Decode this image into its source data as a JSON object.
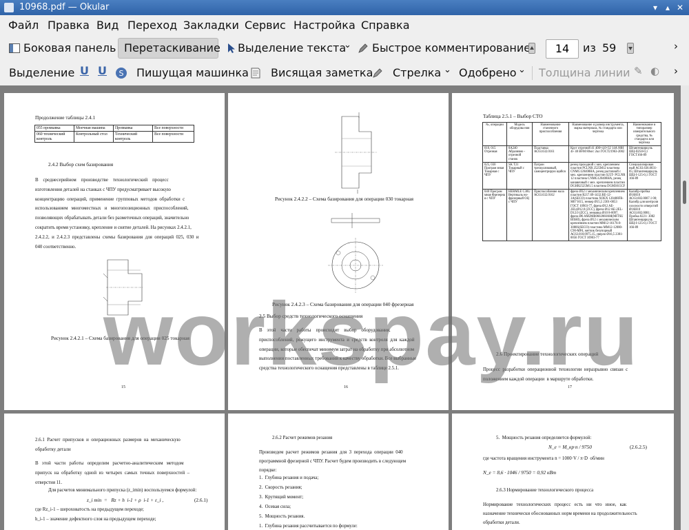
{
  "window": {
    "title": "10968.pdf — Okular"
  },
  "menu": [
    "Файл",
    "Правка",
    "Вид",
    "Переход",
    "Закладки",
    "Сервис",
    "Настройка",
    "Справка"
  ],
  "toolbar1": {
    "sidebar": "Боковая панель",
    "drag": "Перетаскивание",
    "text_select": "Выделение текста",
    "quick_annot": "Быстрое комментирование",
    "page_current": "14",
    "page_of": "из",
    "page_total": "59"
  },
  "toolbar2": {
    "select": "Выделение",
    "typewriter": "Пишущая машинка",
    "note": "Висящая заметка",
    "arrow": "Стрелка",
    "stamp": "Одобрено",
    "line_width": "Толщина линии"
  },
  "watermark": "workspay.ru",
  "page15": {
    "cont": "Продолжение таблицы 2.4.1",
    "table": [
      [
        "055 промывка",
        "Моечная\nмашина",
        "Промывка",
        "Все поверхности"
      ],
      [
        "060\nтехнический\nконтроль",
        "Контрольный\nстол",
        "Технический\nконтроль",
        "Все поверхности"
      ]
    ],
    "heading": "2.4.2 Выбор схем базирования",
    "body": "В    среднесерийном    производстве    технологический    процесс\nизготовления деталей на станках с ЧПУ предусматривает высокую\nконцентрацию  операций,  применение  групповых  методов  обработки  с\nиспользованием   многоместных   и   многопозиционных   приспособлений,\nпозволяющих обрабатывать детали без разметочных операций, значительно\nсократить время установку, крепление и снятие деталей. На рисунках 2.4.2.1,\n2.4.2.2,  и  2.4.2.3  представлены  схемы  базирования  для  операций  025,  030  и\n040 соответственно.",
    "caption": "Рисунок 2.4.2.1 – Схема базирования для операции 025 токарная",
    "num": "15"
  },
  "page16": {
    "caption1": "Рисунок 2.4.2.2 – Схема базирования для операции 030 токарная",
    "caption2": "Рисунок 2.4.2.3 – Схема базирования для операции 040 фрезерная",
    "heading": "2.5 Выбор средств технологического оснащения",
    "body": "В    этой    части    работы    происходит    выбор    оборудования,\nприспособлений,  режущего  инструмента  и  средств  контроля  для  каждой\nоперации, которые обеспечат минимум затрат на обработку при абсолютном\nвыполнении поставленных требований к качеству обработки. Все выбранные\nсредства технологического оснащения представлены в таблице 2.5.1.",
    "num": "16"
  },
  "page17": {
    "table_title": "Таблица 2.5.1 – Выбор СТО",
    "table": [
      [
        "№,\nоперации",
        "Модель\nоборудова\nния",
        "Наименование\nстаночного\nприспособления",
        "Наименование и размер\nинструмента, марка\nматериала, № стандарта\nили чертежа",
        "Наименование и\nтипоразмер\nизмерительного\nсредства, №\nстандарта или\nчертежа"
      ],
      [
        "010, 015\nОтрезная",
        "8А240\nАбразивно\n- отрезной\nстанок",
        "Подставка\nАС63.632.0161",
        "Круг отрезной 41\n400×4,0×32 14А 80Н 4l-\n40 ВFМ 80м/с 2кл\nГОСТ21963-2002",
        "Штангенциркуль\nШЦ-II250-0,1\nГОСТ166-89"
      ],
      [
        "025, 030\nПрограм\nмная\nТокарная\nс ЧПУ",
        "SK T21\nТокарный\nс ЧПУ",
        "Патрон\nтрехкулачковый,\nсамоцентрирую\nщийся",
        "резец проходной с мех.\nкреплением пластин\nPCLNR 2525M12 пластина\nCNMG120408HA, резец\nрасточной с мех.\nкреплением пластин S25T-\nPCLNR 12 пластина\nCNMG120408HA, резец\nканавочный с мех.\nкреплением пластин\nDGHR2525M1.5 пластина\nDGM3015CF",
        "Специализирован\nный\nАС63.636.0031-\n05;\nШтангенциркуль\nШЦ-I-125-0,1\nГОСТ 166-89"
      ],
      [
        "040\nПрограм\nмная\nФрезерна\nя с ЧПУ",
        "HERMLE\nC30U\nВертикаль\nно-\nфрезерный\nОЦ с ЧПУ",
        "Приспособление\nнала\nАС63.632.0162",
        "фреза Ø32 с механическим\nкреплением пластин\nR217.69-1432.RE-12-\n3A(SECO) пластина XOEX\n120408FR-M07 H15, зенкер\nØ15,5 2301-0053 ГОСТ\n10903-77, фреза Ø12 AE-\n2EL(Ø12.0 (ZCC), фреза\nØ12 AE-2EL-D12.0 (ZCC),\nзенковка\nØ10 8-0097, фреза\nØ6\nAM2MB0602060AM(MITSU\nBISHI), фреза Ø12 с\nмеханическим креплением\nпластин MM12-16170.0-\n3080S(SECO) пластина\nMM12-12080-C90-MP4,\nметчик безупорный\nАС63.018.0975.15, сверло\nØ16,5 2301-0056 ГОСТ\n10903-77",
        "Калибр-пробка\nØ16Н10\nАС63.602.0007.1\n00; Калибр для\nконтроля\nсоосности\nотверстий\nØ16Н10\nАС63.602.0081;\nПробка 8221-\n3082\nШтангенциркуль\nШЦ-I-125-0,1\nГОСТ 166-89"
      ]
    ],
    "heading": "2.6 Проектирование технологических операций",
    "body": "Процесс  разработки  операционной  технологии  неразрывно  связан  с\nположением каждой операции  в маршруте обработки.",
    "num": "17"
  },
  "page18": {
    "heading": "2.6.1  Расчет  припусков  и  операционных  размеров  на  механическую\nобработку детали",
    "body": "В   этой   части   работы   определим   расчетно-аналитическим   методом\nприпуск  на  обработку  одной  из  четырех  самых  точных  поверхностей  –\nотверстия 11.",
    "formula_intro": "Для расчетов минимального припуска (z_imin) воспользуемся формулой:",
    "formula": "z_i min  =   Rz + h  i-1 + ρ  i-1 + ε_i ,",
    "formula_num": "(2.6.1)",
    "where1": "где Rz_i-1 – шероховатость на предыдущем переходе;",
    "where2": "h_i-1 – значение дефектного слоя на предыдущем переходе;"
  },
  "page19": {
    "heading": "2.6.2 Расчет режимов резания",
    "body": "Произведем  расчет  режимов  резания  для  3  перехода  операции  040\nпрограммной фрезерной с ЧПУ. Расчет будем производить в следующем\nпорядке:",
    "list": [
      "1.  Глубина резания и подача;",
      "2.  Скорость резания;",
      "3.  Крутящий момент;",
      "4.  Осевая сила;",
      "5.  Мощность резания."
    ],
    "cut": "1.  Глубина резания рассчитывается по формуле:"
  },
  "page20": {
    "item5": "5.  Мощность резания определяется формулой:",
    "formula1": "N_e = M_кр·n / 9750",
    "formula1_num": "(2.6.2.5)",
    "where": "где частота вращения инструмента n = 1000·V / π·D  об/мин",
    "formula2": "N_e = 8,6 · 1046 / 9750 = 0,92 кВт",
    "heading": "2.6.3 Нормирование технологического процесса",
    "body": "Нормирование   технологических   процесс   есть   ни   что   иное,   как\nназначение технически обоснованных норм времени на продолжительность\nобработки детали."
  }
}
